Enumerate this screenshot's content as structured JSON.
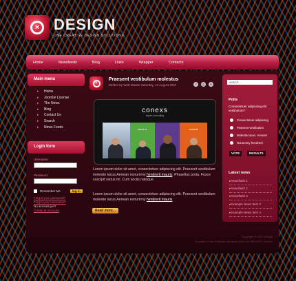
{
  "brand": {
    "title": "DESIGN",
    "tagline": "ONE CREATIVE DESIGN SOLUTIONS",
    "logo_glyph": "×"
  },
  "nav": [
    "Home",
    "Newsfeeds",
    "Blog",
    "Links",
    "Wrapper",
    "Contacts"
  ],
  "main_menu": {
    "title": "Main menu",
    "items": [
      "Home",
      "Joomla! License",
      "The News",
      "Blog",
      "Contact Us",
      "Search",
      "News Feeds"
    ]
  },
  "login": {
    "title": "Login form",
    "username_label": "Username",
    "password_label": "Password",
    "remember_label": "Remember Me",
    "button": "log in",
    "forgot_password": "Forgot your password?",
    "forgot_username": "Forgot your username?",
    "no_account": "No account yet?",
    "create_account": "Create an account"
  },
  "post": {
    "title": "Praesent vestibulum molestus",
    "author": "Written by Web Master",
    "date": "Saturday, 12 August 2007",
    "tools": [
      "pdf-icon",
      "print-icon",
      "email-icon"
    ],
    "screen_brand": "conexs",
    "screen_tag": "expert consulting",
    "tile_about": "about us",
    "tile_contacts": "contacts",
    "para1_a": "Lorem ipsum dolor sit amet, consectetuer adipiscing elit. Praesent vestibulum molestie lacus.Aenean nonummy ",
    "para1_link": "hendrerit mauris",
    "para1_b": ". Phasellus porta. Fusce suscipit varius mi. Cum sociis natoque",
    "para2_a": "Lorem ipsum dolor sit amet, consectetuer adipiscing elit. Praesent vestibulum molestie lacus.Aenean nonummy ",
    "para2_link": "hendrerit mauris",
    "para2_b": ".",
    "read_more": "Read more..."
  },
  "search": {
    "placeholder": "search..."
  },
  "poll": {
    "title": "Polls",
    "question": "Consectetuer adipiscing elit vestibulum?",
    "options": [
      "Consectetuer adipiscing",
      "Praesent vestibulum",
      "Molestie lacus. Aenean",
      "Nonummy hendrerit"
    ],
    "vote": "VOTE",
    "results": "RESULTS"
  },
  "latest_news": {
    "title": "Latest news",
    "items": [
      "Newsflash 1",
      "Newsflash 2",
      "Newsflash 3",
      "Example News Item 2",
      "Example News Item 4"
    ]
  },
  "footer": {
    "line1": "Copyright © 2007 Design",
    "line2": "Joomla! is Free Software released under the GNU/GPL License"
  }
}
